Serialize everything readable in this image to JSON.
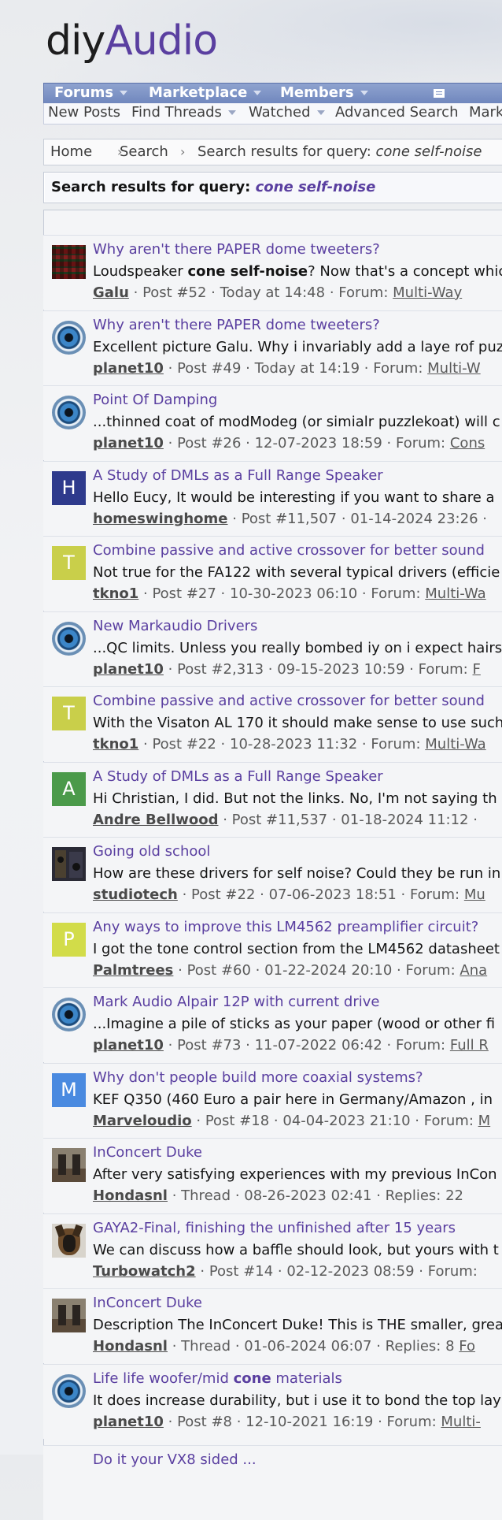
{
  "logo": {
    "diy": "diy",
    "audio": "Audio"
  },
  "nav": {
    "tabs": [
      "Forums",
      "Marketplace",
      "Members"
    ]
  },
  "subnav": {
    "links": [
      "New Posts",
      "Find Threads",
      "Watched",
      "Advanced Search",
      "Mark"
    ]
  },
  "breadcrumb": {
    "home": "Home",
    "search": "Search",
    "current_prefix": "Search results for query: ",
    "current_query": "cone self-noise"
  },
  "page_title": {
    "prefix": "Search results for query: ",
    "query": "cone self-noise"
  },
  "results": [
    {
      "title": "Why aren't there PAPER dome tweeters?",
      "snippet_pre": "Loudspeaker ",
      "snippet_bold": "cone self-noise",
      "snippet_post": "? Now that's a concept which",
      "user": "Galu",
      "post": "Post #52",
      "date": "Today at 14:48",
      "forum_label": "Forum:",
      "forum": "Multi-Way",
      "avatar": "tartan"
    },
    {
      "title": "Why aren't there PAPER dome tweeters?",
      "snippet_pre": "Excellent picture Galu. Why i invariably add a laye rof puzz",
      "snippet_bold": "",
      "snippet_post": "",
      "user": "planet10",
      "post": "Post #49",
      "date": "Today at 14:19",
      "forum_label": "Forum:",
      "forum": "Multi-W",
      "avatar": "eye"
    },
    {
      "title": "Point Of Damping",
      "snippet_pre": "...thinned coat of modModeg (or simialr puzzlekoat) will c",
      "snippet_bold": "",
      "snippet_post": "",
      "user": "planet10",
      "post": "Post #26",
      "date": "12-07-2023 18:59",
      "forum_label": "Forum:",
      "forum": "Cons",
      "avatar": "eye"
    },
    {
      "title": "A Study of DMLs as a Full Range Speaker",
      "snippet_pre": "Hello Eucy, It would be interesting if you want to share a",
      "snippet_bold": "",
      "snippet_post": "",
      "user": "homeswinghome",
      "post": "Post #11,507",
      "date": "01-14-2024 23:26",
      "forum_label": "",
      "forum": "",
      "avatar": "H",
      "avatar_color": "#2e3a8c"
    },
    {
      "title": "Combine passive and active crossover for better sound",
      "snippet_pre": "Not true for the FA122 with several typical drivers (efficie",
      "snippet_bold": "",
      "snippet_post": "",
      "user": "tkno1",
      "post": "Post #27",
      "date": "10-30-2023 06:10",
      "forum_label": "Forum:",
      "forum": "Multi-Wa",
      "avatar": "T",
      "avatar_color": "#c9cf4a"
    },
    {
      "title": "New Markaudio Drivers",
      "snippet_pre": "...QC limits. Unless you really bombed iy on i expect hairs",
      "snippet_bold": "",
      "snippet_post": "",
      "user": "planet10",
      "post": "Post #2,313",
      "date": "09-15-2023 10:59",
      "forum_label": "Forum:",
      "forum": "F",
      "avatar": "eye"
    },
    {
      "title": "Combine passive and active crossover for better sound",
      "snippet_pre": "With the Visaton AL 170 it should make sense to use such",
      "snippet_bold": "",
      "snippet_post": "",
      "user": "tkno1",
      "post": "Post #22",
      "date": "10-28-2023 11:32",
      "forum_label": "Forum:",
      "forum": "Multi-Wa",
      "avatar": "T",
      "avatar_color": "#c9cf4a"
    },
    {
      "title": "A Study of DMLs as a Full Range Speaker",
      "snippet_pre": "Hi Christian, I did. But not the links. No, I'm not saying th",
      "snippet_bold": "",
      "snippet_post": "",
      "user": "Andre Bellwood",
      "post": "Post #11,537",
      "date": "01-18-2024 11:12",
      "forum_label": "",
      "forum": "",
      "avatar": "A",
      "avatar_color": "#4b9a4a"
    },
    {
      "title": "Going old school",
      "snippet_pre": "How are these drivers for self noise? Could they be run in",
      "snippet_bold": "",
      "snippet_post": "",
      "user": "studiotech",
      "post": "Post #22",
      "date": "07-06-2023 18:51",
      "forum_label": "Forum:",
      "forum": "Mu",
      "avatar": "speakers"
    },
    {
      "title": "Any ways to improve this LM4562 preamplifier circuit?",
      "snippet_pre": "I got the tone control section from the LM4562 datasheet",
      "snippet_bold": "",
      "snippet_post": "",
      "user": "Palmtrees",
      "post": "Post #60",
      "date": "01-22-2024 20:10",
      "forum_label": "Forum:",
      "forum": "Ana",
      "avatar": "P",
      "avatar_color": "#d2dc49"
    },
    {
      "title": "Mark Audio Alpair 12P with current drive",
      "snippet_pre": "...Imagine a pile of sticks as your paper (wood or other fi",
      "snippet_bold": "",
      "snippet_post": "",
      "user": "planet10",
      "post": "Post #73",
      "date": "11-07-2022 06:42",
      "forum_label": "Forum:",
      "forum": "Full R",
      "avatar": "eye"
    },
    {
      "title": "Why don't people build more coaxial systems?",
      "snippet_pre": "KEF Q350 (460 Euro a pair here in Germany/Amazon , in",
      "snippet_bold": "",
      "snippet_post": "",
      "user": "Marveloudio",
      "post": "Post #18",
      "date": "04-04-2023 21:10",
      "forum_label": "Forum:",
      "forum": "M",
      "avatar": "M",
      "avatar_color": "#4a8ae0"
    },
    {
      "title": "InConcert Duke",
      "snippet_pre": "After very satisfying experiences with my previous InCon",
      "snippet_bold": "",
      "snippet_post": "",
      "user": "Hondasnl",
      "post": "Thread",
      "date": "08-26-2023 02:41",
      "forum_label": "Replies: 22",
      "forum": "",
      "avatar": "room"
    },
    {
      "title": "GAYA2-Final, finishing the unfinished after 15 years",
      "snippet_pre": "We can discuss how a baffle should look, but yours with t",
      "snippet_bold": "",
      "snippet_post": "",
      "user": "Turbowatch2",
      "post": "Post #14",
      "date": "02-12-2023 08:59",
      "forum_label": "Forum:",
      "forum": "",
      "avatar": "dog"
    },
    {
      "title": "InConcert Duke",
      "snippet_pre": "Description The InConcert Duke! This is THE smaller, grea",
      "snippet_bold": "",
      "snippet_post": "",
      "user": "Hondasnl",
      "post": "Thread",
      "date": "01-06-2024 06:07",
      "forum_label": "Replies: 8",
      "forum": "Fo",
      "avatar": "room"
    },
    {
      "title_pre": "Life life woofer/mid ",
      "title_bold": "cone",
      "title_post": " materials",
      "title": "",
      "snippet_pre": "It does increase durability, but i use it to bond the top lay",
      "snippet_bold": "",
      "snippet_post": "",
      "user": "planet10",
      "post": "Post #8",
      "date": "12-10-2021 16:19",
      "forum_label": "Forum:",
      "forum": "Multi-",
      "avatar": "eye"
    }
  ],
  "partial_last_title": "Do it your VX8 sided ..."
}
